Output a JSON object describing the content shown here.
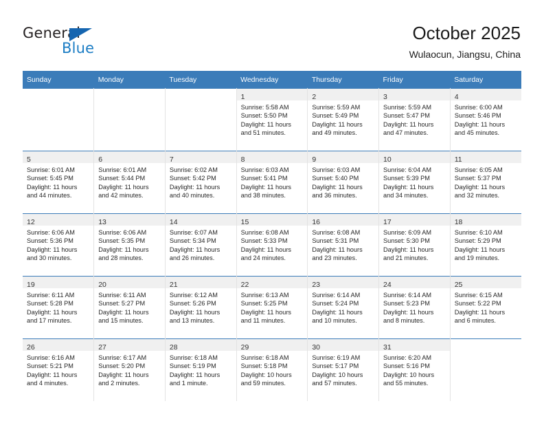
{
  "brand": {
    "name_part1": "General",
    "name_part2": "Blue",
    "triangle_color": "#1565b0",
    "blue_text_color": "#1a7cc4"
  },
  "header": {
    "title": "October 2025",
    "subtitle": "Wulaocun, Jiangsu, China",
    "accent_color": "#3b7cb9"
  },
  "weekdays": [
    "Sunday",
    "Monday",
    "Tuesday",
    "Wednesday",
    "Thursday",
    "Friday",
    "Saturday"
  ],
  "weeks": [
    [
      {
        "day": "",
        "sunrise": "",
        "sunset": "",
        "daylight1": "",
        "daylight2": "",
        "blank": true
      },
      {
        "day": "",
        "sunrise": "",
        "sunset": "",
        "daylight1": "",
        "daylight2": "",
        "blank": true
      },
      {
        "day": "",
        "sunrise": "",
        "sunset": "",
        "daylight1": "",
        "daylight2": "",
        "blank": true
      },
      {
        "day": "1",
        "sunrise": "Sunrise: 5:58 AM",
        "sunset": "Sunset: 5:50 PM",
        "daylight1": "Daylight: 11 hours",
        "daylight2": "and 51 minutes."
      },
      {
        "day": "2",
        "sunrise": "Sunrise: 5:59 AM",
        "sunset": "Sunset: 5:49 PM",
        "daylight1": "Daylight: 11 hours",
        "daylight2": "and 49 minutes."
      },
      {
        "day": "3",
        "sunrise": "Sunrise: 5:59 AM",
        "sunset": "Sunset: 5:47 PM",
        "daylight1": "Daylight: 11 hours",
        "daylight2": "and 47 minutes."
      },
      {
        "day": "4",
        "sunrise": "Sunrise: 6:00 AM",
        "sunset": "Sunset: 5:46 PM",
        "daylight1": "Daylight: 11 hours",
        "daylight2": "and 45 minutes."
      }
    ],
    [
      {
        "day": "5",
        "sunrise": "Sunrise: 6:01 AM",
        "sunset": "Sunset: 5:45 PM",
        "daylight1": "Daylight: 11 hours",
        "daylight2": "and 44 minutes."
      },
      {
        "day": "6",
        "sunrise": "Sunrise: 6:01 AM",
        "sunset": "Sunset: 5:44 PM",
        "daylight1": "Daylight: 11 hours",
        "daylight2": "and 42 minutes."
      },
      {
        "day": "7",
        "sunrise": "Sunrise: 6:02 AM",
        "sunset": "Sunset: 5:42 PM",
        "daylight1": "Daylight: 11 hours",
        "daylight2": "and 40 minutes."
      },
      {
        "day": "8",
        "sunrise": "Sunrise: 6:03 AM",
        "sunset": "Sunset: 5:41 PM",
        "daylight1": "Daylight: 11 hours",
        "daylight2": "and 38 minutes."
      },
      {
        "day": "9",
        "sunrise": "Sunrise: 6:03 AM",
        "sunset": "Sunset: 5:40 PM",
        "daylight1": "Daylight: 11 hours",
        "daylight2": "and 36 minutes."
      },
      {
        "day": "10",
        "sunrise": "Sunrise: 6:04 AM",
        "sunset": "Sunset: 5:39 PM",
        "daylight1": "Daylight: 11 hours",
        "daylight2": "and 34 minutes."
      },
      {
        "day": "11",
        "sunrise": "Sunrise: 6:05 AM",
        "sunset": "Sunset: 5:37 PM",
        "daylight1": "Daylight: 11 hours",
        "daylight2": "and 32 minutes."
      }
    ],
    [
      {
        "day": "12",
        "sunrise": "Sunrise: 6:06 AM",
        "sunset": "Sunset: 5:36 PM",
        "daylight1": "Daylight: 11 hours",
        "daylight2": "and 30 minutes."
      },
      {
        "day": "13",
        "sunrise": "Sunrise: 6:06 AM",
        "sunset": "Sunset: 5:35 PM",
        "daylight1": "Daylight: 11 hours",
        "daylight2": "and 28 minutes."
      },
      {
        "day": "14",
        "sunrise": "Sunrise: 6:07 AM",
        "sunset": "Sunset: 5:34 PM",
        "daylight1": "Daylight: 11 hours",
        "daylight2": "and 26 minutes."
      },
      {
        "day": "15",
        "sunrise": "Sunrise: 6:08 AM",
        "sunset": "Sunset: 5:33 PM",
        "daylight1": "Daylight: 11 hours",
        "daylight2": "and 24 minutes."
      },
      {
        "day": "16",
        "sunrise": "Sunrise: 6:08 AM",
        "sunset": "Sunset: 5:31 PM",
        "daylight1": "Daylight: 11 hours",
        "daylight2": "and 23 minutes."
      },
      {
        "day": "17",
        "sunrise": "Sunrise: 6:09 AM",
        "sunset": "Sunset: 5:30 PM",
        "daylight1": "Daylight: 11 hours",
        "daylight2": "and 21 minutes."
      },
      {
        "day": "18",
        "sunrise": "Sunrise: 6:10 AM",
        "sunset": "Sunset: 5:29 PM",
        "daylight1": "Daylight: 11 hours",
        "daylight2": "and 19 minutes."
      }
    ],
    [
      {
        "day": "19",
        "sunrise": "Sunrise: 6:11 AM",
        "sunset": "Sunset: 5:28 PM",
        "daylight1": "Daylight: 11 hours",
        "daylight2": "and 17 minutes."
      },
      {
        "day": "20",
        "sunrise": "Sunrise: 6:11 AM",
        "sunset": "Sunset: 5:27 PM",
        "daylight1": "Daylight: 11 hours",
        "daylight2": "and 15 minutes."
      },
      {
        "day": "21",
        "sunrise": "Sunrise: 6:12 AM",
        "sunset": "Sunset: 5:26 PM",
        "daylight1": "Daylight: 11 hours",
        "daylight2": "and 13 minutes."
      },
      {
        "day": "22",
        "sunrise": "Sunrise: 6:13 AM",
        "sunset": "Sunset: 5:25 PM",
        "daylight1": "Daylight: 11 hours",
        "daylight2": "and 11 minutes."
      },
      {
        "day": "23",
        "sunrise": "Sunrise: 6:14 AM",
        "sunset": "Sunset: 5:24 PM",
        "daylight1": "Daylight: 11 hours",
        "daylight2": "and 10 minutes."
      },
      {
        "day": "24",
        "sunrise": "Sunrise: 6:14 AM",
        "sunset": "Sunset: 5:23 PM",
        "daylight1": "Daylight: 11 hours",
        "daylight2": "and 8 minutes."
      },
      {
        "day": "25",
        "sunrise": "Sunrise: 6:15 AM",
        "sunset": "Sunset: 5:22 PM",
        "daylight1": "Daylight: 11 hours",
        "daylight2": "and 6 minutes."
      }
    ],
    [
      {
        "day": "26",
        "sunrise": "Sunrise: 6:16 AM",
        "sunset": "Sunset: 5:21 PM",
        "daylight1": "Daylight: 11 hours",
        "daylight2": "and 4 minutes."
      },
      {
        "day": "27",
        "sunrise": "Sunrise: 6:17 AM",
        "sunset": "Sunset: 5:20 PM",
        "daylight1": "Daylight: 11 hours",
        "daylight2": "and 2 minutes."
      },
      {
        "day": "28",
        "sunrise": "Sunrise: 6:18 AM",
        "sunset": "Sunset: 5:19 PM",
        "daylight1": "Daylight: 11 hours",
        "daylight2": "and 1 minute."
      },
      {
        "day": "29",
        "sunrise": "Sunrise: 6:18 AM",
        "sunset": "Sunset: 5:18 PM",
        "daylight1": "Daylight: 10 hours",
        "daylight2": "and 59 minutes."
      },
      {
        "day": "30",
        "sunrise": "Sunrise: 6:19 AM",
        "sunset": "Sunset: 5:17 PM",
        "daylight1": "Daylight: 10 hours",
        "daylight2": "and 57 minutes."
      },
      {
        "day": "31",
        "sunrise": "Sunrise: 6:20 AM",
        "sunset": "Sunset: 5:16 PM",
        "daylight1": "Daylight: 10 hours",
        "daylight2": "and 55 minutes."
      },
      {
        "day": "",
        "sunrise": "",
        "sunset": "",
        "daylight1": "",
        "daylight2": "",
        "blank": true
      }
    ]
  ]
}
